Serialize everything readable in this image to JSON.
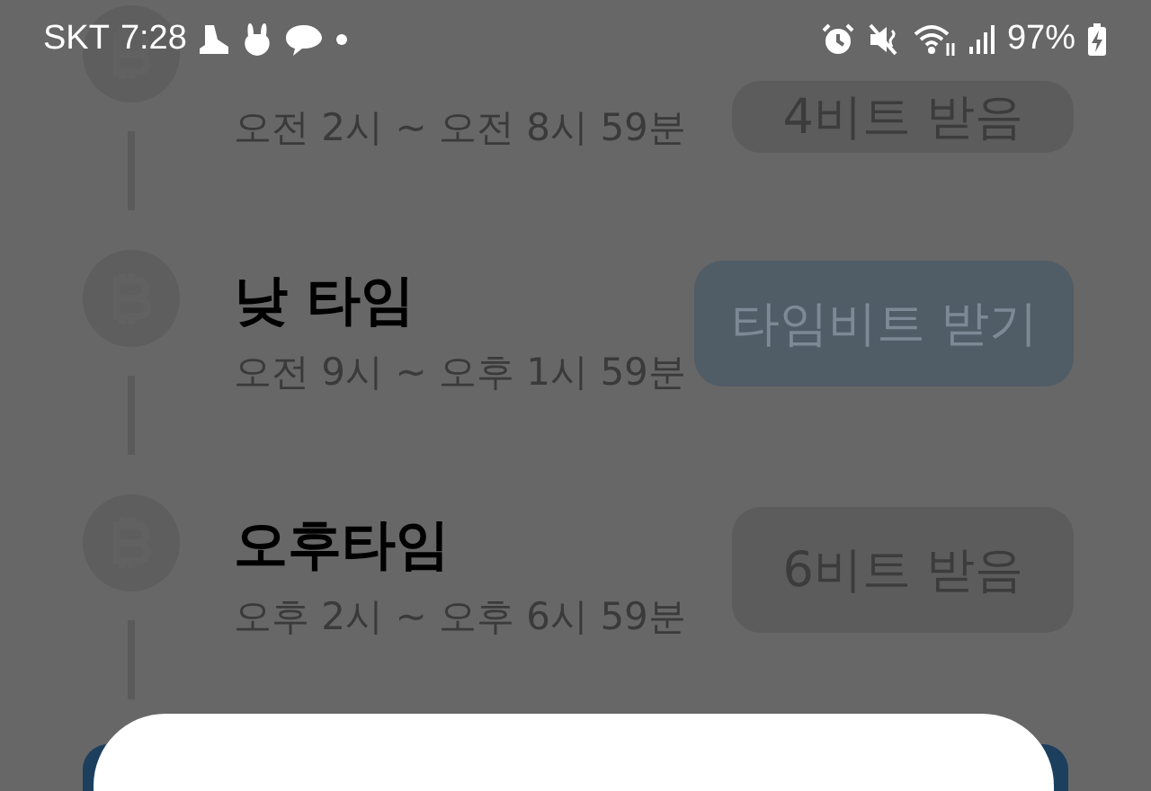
{
  "status_bar": {
    "carrier": "SKT",
    "time": "7:28",
    "battery": "97%"
  },
  "slots": [
    {
      "time_range": "오전 2시 ~ 오전 8시 59분",
      "button": "4비트 받음",
      "claimed": true
    },
    {
      "title": "낮 타임",
      "time_range": "오전 9시 ~ 오후 1시 59분",
      "button": "타임비트 받기",
      "claimed": false
    },
    {
      "title": "오후타임",
      "time_range": "오후 2시 ~ 오후 6시 59분",
      "button": "6비트 받음",
      "claimed": true
    }
  ]
}
